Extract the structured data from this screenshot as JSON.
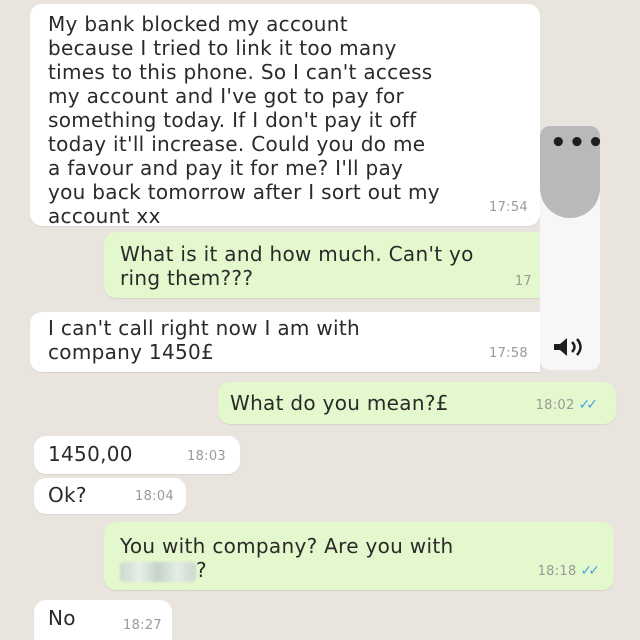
{
  "messages": [
    {
      "direction": "in",
      "text": "My bank blocked my account\nbecause I tried to link it too many\ntimes to this phone. So I can't access\nmy account and I've got to pay for\nsomething today. If I don't pay it off\ntoday it'll increase. Could you do me\na favour and pay it for me? I'll pay\nyou back tomorrow after I sort out my\naccount xx",
      "time": "17:54"
    },
    {
      "direction": "out",
      "text": "What is it and how much. Can't yo\nring them???",
      "time": "17"
    },
    {
      "direction": "in",
      "text": "I can't call right now I am with\ncompany 1450£",
      "time": "17:58"
    },
    {
      "direction": "out",
      "text": "What do you mean?£",
      "time": "18:02",
      "ticks": "✓✓"
    },
    {
      "direction": "in",
      "text": "1450,00",
      "time": "18:03"
    },
    {
      "direction": "in",
      "text": "Ok?",
      "time": "18:04"
    },
    {
      "direction": "out",
      "text_line1": "You with company? Are you with",
      "text_line2_suffix": "?",
      "time": "18:18",
      "ticks": "✓✓"
    },
    {
      "direction": "in",
      "text": "No",
      "time": "18:27"
    }
  ],
  "overlay": {
    "menu_icon": "more-options-icon",
    "menu_glyph": "•••",
    "audio_icon": "speaker-icon"
  },
  "colors": {
    "background": "#e9e4dd",
    "incoming_bubble": "#ffffff",
    "outgoing_bubble": "#e3f8cc",
    "read_ticks": "#4aa3e0"
  }
}
